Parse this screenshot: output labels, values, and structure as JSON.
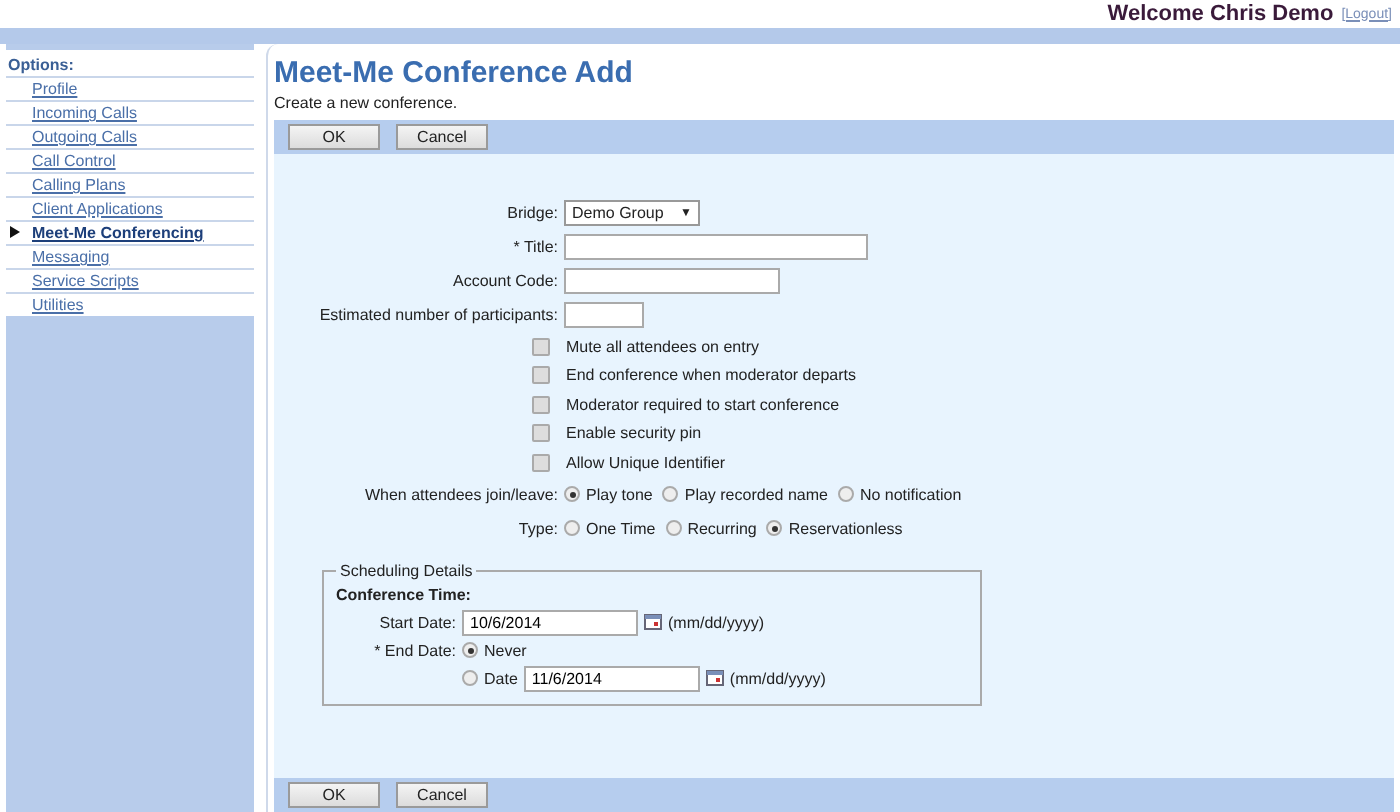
{
  "header": {
    "welcome": "Welcome Chris Demo",
    "logout": "[Logout]"
  },
  "sidebar": {
    "heading": "Options:",
    "items": [
      {
        "label": "Profile",
        "selected": false
      },
      {
        "label": "Incoming Calls",
        "selected": false
      },
      {
        "label": "Outgoing Calls",
        "selected": false
      },
      {
        "label": "Call Control",
        "selected": false
      },
      {
        "label": "Calling Plans",
        "selected": false
      },
      {
        "label": "Client Applications",
        "selected": false
      },
      {
        "label": "Meet-Me Conferencing",
        "selected": true
      },
      {
        "label": "Messaging",
        "selected": false
      },
      {
        "label": "Service Scripts",
        "selected": false
      },
      {
        "label": "Utilities",
        "selected": false
      }
    ]
  },
  "page": {
    "title": "Meet-Me Conference Add",
    "subtitle": "Create a new conference.",
    "top_buttons": [
      "OK",
      "Cancel"
    ],
    "fields": [
      {
        "kind": "select",
        "label": "Bridge:",
        "value": "Demo Group",
        "arrow": "▼"
      },
      {
        "kind": "text",
        "label": "* Title:"
      },
      {
        "kind": "text",
        "label": "Account Code:"
      },
      {
        "kind": "text",
        "label": "Estimated number of participants:"
      },
      {
        "kind": "checkbox",
        "label": "Mute all attendees on entry",
        "checked": false
      },
      {
        "kind": "checkbox",
        "label": "End conference when moderator departs",
        "checked": false
      },
      {
        "kind": "checkbox",
        "label": "Moderator required to start conference",
        "checked": false
      },
      {
        "kind": "checkbox",
        "label": "Enable security pin",
        "checked": false
      },
      {
        "kind": "checkbox",
        "label": "Allow Unique Identifier",
        "checked": false
      },
      {
        "kind": "radios",
        "label": "When attendees join/leave:",
        "options": [
          {
            "label": "Play tone",
            "selected": true
          },
          {
            "label": "Play recorded name",
            "selected": false
          },
          {
            "label": "No notification",
            "selected": false
          }
        ]
      },
      {
        "kind": "radios",
        "label": "Type:",
        "options": [
          {
            "label": "One Time",
            "selected": false
          },
          {
            "label": "Recurring",
            "selected": false
          },
          {
            "label": "Reservationless",
            "selected": true
          }
        ]
      }
    ],
    "scheduling": {
      "legend": "Scheduling Details",
      "heading": "Conference Time:",
      "start_date": {
        "label": "Start Date:",
        "value": "10/6/2014",
        "hint": "(mm/dd/yyyy)"
      },
      "end_date": {
        "label": "* End Date:",
        "options": [
          {
            "label": "Never",
            "selected": true
          },
          {
            "label": "Date",
            "selected": false,
            "value": "11/6/2014",
            "hint": "(mm/dd/yyyy)"
          }
        ]
      }
    },
    "bottom_buttons": [
      "OK",
      "Cancel"
    ]
  }
}
